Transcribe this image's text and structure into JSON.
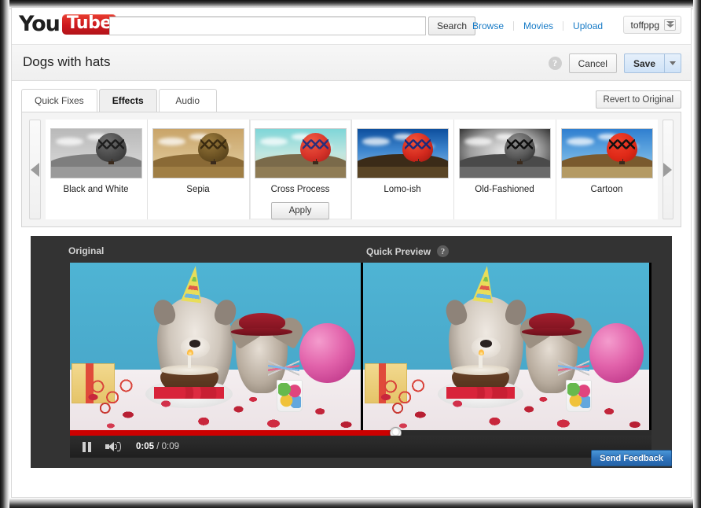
{
  "masthead": {
    "logo_you": "You",
    "logo_tube": "Tube",
    "search_value": "",
    "search_placeholder": "",
    "search_button": "Search",
    "links": [
      "Browse",
      "Movies",
      "Upload"
    ],
    "username": "toffppg"
  },
  "titlebar": {
    "title": "Dogs with hats",
    "help": "?",
    "cancel": "Cancel",
    "save": "Save"
  },
  "tabs": [
    {
      "label": "Quick Fixes",
      "active": false
    },
    {
      "label": "Effects",
      "active": true
    },
    {
      "label": "Audio",
      "active": false
    }
  ],
  "revert_button": "Revert to Original",
  "carousel": {
    "prev_icon": "triangle-left-icon",
    "next_icon": "triangle-right-icon",
    "apply_label": "Apply",
    "selected_effect": "Cross Process",
    "effects": [
      {
        "label": "Black and White",
        "sky": "linear-gradient(180deg,#b9b9b9 0%, #cdcdcd 55%, #dedede 100%)",
        "hill": "#7e7e7e",
        "ground": "#9a9a9a",
        "balloon": "radial-gradient(circle at 38% 28%, #6f6f6f 0%, #4a4a4a 55%, #303030 100%)",
        "zig": "#1d1d1d"
      },
      {
        "label": "Sepia",
        "sky": "linear-gradient(180deg,#c9a468 0%, #d8bd8a 55%, #e2cfa4 100%)",
        "hill": "#8a6a36",
        "ground": "#a07f45",
        "balloon": "radial-gradient(circle at 38% 28%, #9a7a3c 0%, #6e5424 55%, #4a3715 100%)",
        "zig": "#3b2b10"
      },
      {
        "label": "Cross Process",
        "sky": "linear-gradient(180deg,#7fd6d8 0%, #bfe6e0 50%, #ded9b8 100%)",
        "hill": "#7a6a4a",
        "ground": "#8f7c55",
        "balloon": "radial-gradient(circle at 38% 28%, #ef5a42 0%, #d8342a 55%, #a81d18 100%)",
        "zig": "#2a2f7a"
      },
      {
        "label": "Lomo-ish",
        "sky": "linear-gradient(180deg,#0d4f9e 0%, #3f87cf 45%, #9fc4e4 100%)",
        "hill": "#3b2b18",
        "ground": "#5a4526",
        "balloon": "radial-gradient(circle at 38% 28%, #f2543a 0%, #d42a1e 55%, #9b160f 100%)",
        "zig": "#1b2a7a"
      },
      {
        "label": "Old-Fashioned",
        "sky": "radial-gradient(ellipse at 50% 45%, #e8e8e8 0%, #9d9d9d 55%, #1a1a1a 100%)",
        "hill": "#4a4a4a",
        "ground": "#6a6a6a",
        "balloon": "radial-gradient(circle at 38% 28%, #8a8a8a 0%, #5a5a5a 55%, #242424 100%)",
        "zig": "#0d0d0d"
      },
      {
        "label": "Cartoon",
        "sky": "linear-gradient(180deg,#2f7fd0 0%, #5fa5df 45%, #9fd0ee 100%)",
        "hill": "#7a5a2e",
        "ground": "#b49a64",
        "balloon": "radial-gradient(circle at 38% 28%, #f0412c 0%, #e02a18 55%, #b81c0e 100%)",
        "zig": "#111111"
      }
    ]
  },
  "preview": {
    "original_label": "Original",
    "quick_preview_label": "Quick Preview",
    "help": "?"
  },
  "player": {
    "pause_icon": "pause-icon",
    "volume_icon": "volume-icon",
    "current_time": "0:05",
    "separator": " / ",
    "duration": "0:09",
    "progress_percent": 56
  },
  "feedback_button": "Send Feedback",
  "colors": {
    "youtube_red": "#cc181e",
    "link_blue": "#167ac6",
    "progress_red": "#cc0000",
    "feedback_blue": "#2f73bb",
    "stage_dark": "#333333"
  }
}
